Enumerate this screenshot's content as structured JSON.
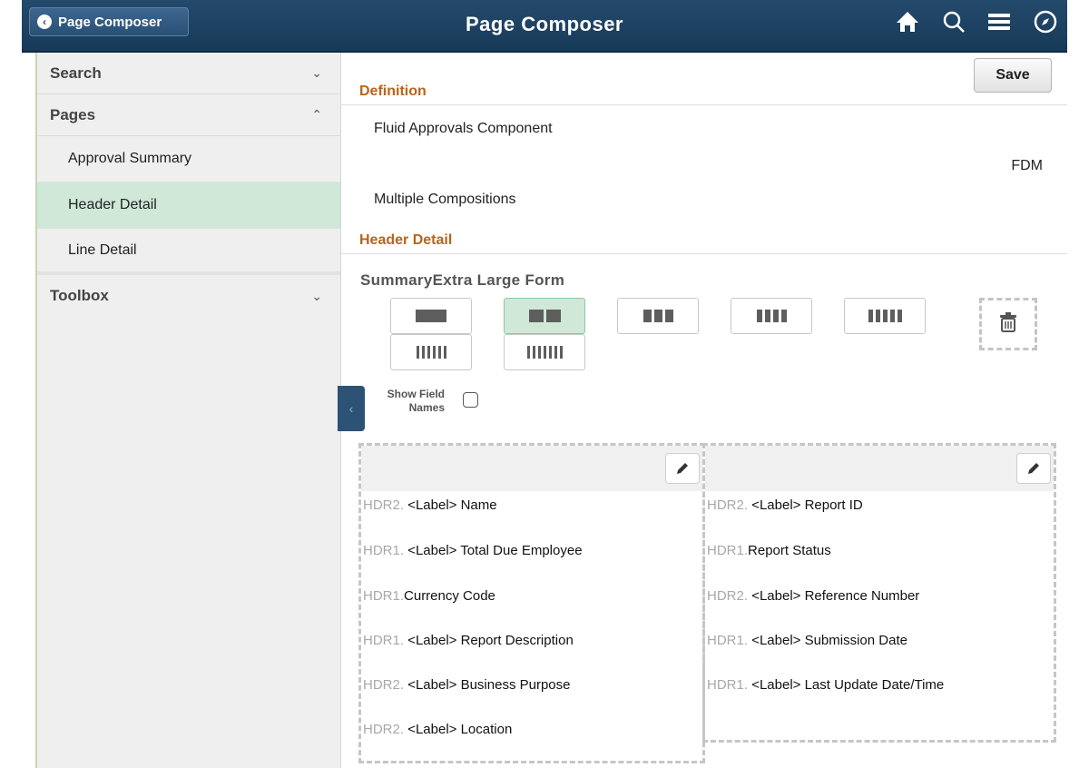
{
  "banner": {
    "back_label": "Page Composer",
    "title": "Page Composer",
    "icons": [
      "home-icon",
      "search-icon",
      "menu-icon",
      "compass-icon"
    ],
    "colors": {
      "background": "#1e4263",
      "accent": "#b5651d",
      "selected": "#cfe8d8"
    }
  },
  "sidebar": {
    "search_label": "Search",
    "pages_label": "Pages",
    "pages": [
      {
        "label": "Approval Summary",
        "selected": false
      },
      {
        "label": "Header Detail",
        "selected": true
      },
      {
        "label": "Line Detail",
        "selected": false
      }
    ],
    "toolbox_label": "Toolbox"
  },
  "main": {
    "save_label": "Save",
    "definition": {
      "title": "Definition",
      "component": "Fluid Approvals Component",
      "code": "FDM",
      "compositions": "Multiple Compositions"
    },
    "header_detail": {
      "title": "Header Detail",
      "form_title": "SummaryExtra Large Form",
      "layouts": [
        1,
        2,
        3,
        4,
        5,
        6,
        7
      ],
      "active_layout": 2,
      "show_field_names_line1": "Show Field",
      "show_field_names_line2": "Names",
      "show_field_names_checked": false
    },
    "columns": [
      {
        "fields": [
          {
            "prefix": "HDR2.",
            "label": "<Label> Name"
          },
          {
            "prefix": "HDR1.",
            "label": "<Label> Total Due Employee"
          },
          {
            "prefix": "HDR1.",
            "label": "Currency Code"
          },
          {
            "prefix": "HDR1.",
            "label": "<Label> Report Description"
          },
          {
            "prefix": "HDR2.",
            "label": "<Label> Business Purpose"
          },
          {
            "prefix": "HDR2.",
            "label": "<Label> Location"
          }
        ]
      },
      {
        "fields": [
          {
            "prefix": "HDR2.",
            "label": "<Label> Report ID"
          },
          {
            "prefix": "HDR1.",
            "label": "Report Status"
          },
          {
            "prefix": "HDR2.",
            "label": "<Label> Reference Number"
          },
          {
            "prefix": "HDR1.",
            "label": "<Label> Submission Date"
          },
          {
            "prefix": "HDR1.",
            "label": "<Label> Last Update Date/Time"
          }
        ]
      }
    ]
  }
}
